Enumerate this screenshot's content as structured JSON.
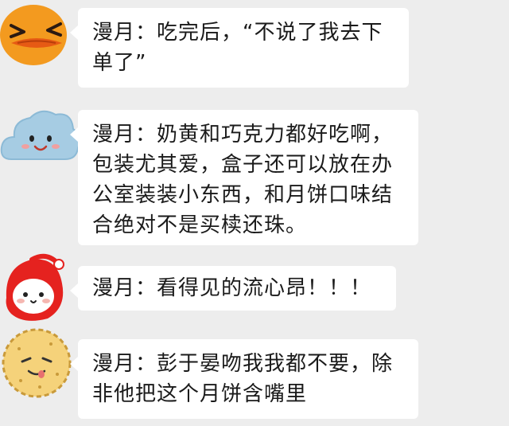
{
  "messages": [
    {
      "avatar_icon": "duck-face-icon",
      "text": "漫月：吃完后，“不说了我去下单了”"
    },
    {
      "avatar_icon": "cloud-face-icon",
      "text": "漫月：奶黄和巧克力都好吃啊，包装尤其爱，盒子还可以放在办公室装装小东西，和月饼口味结合绝对不是买椟还珠。"
    },
    {
      "avatar_icon": "red-hood-character-icon",
      "text": "漫月：看得见的流心昂！！！"
    },
    {
      "avatar_icon": "cookie-face-icon",
      "text": "漫月：彭于晏吻我我都不要，除非他把这个月饼含嘴里"
    }
  ],
  "colors": {
    "background": "#ededed",
    "bubble": "#ffffff",
    "text": "#1a1a1a",
    "duck_orange": "#f39a1f",
    "cloud_blue": "#a6cce3",
    "hood_red": "#e5221f",
    "cookie_yellow": "#f5d27a"
  }
}
